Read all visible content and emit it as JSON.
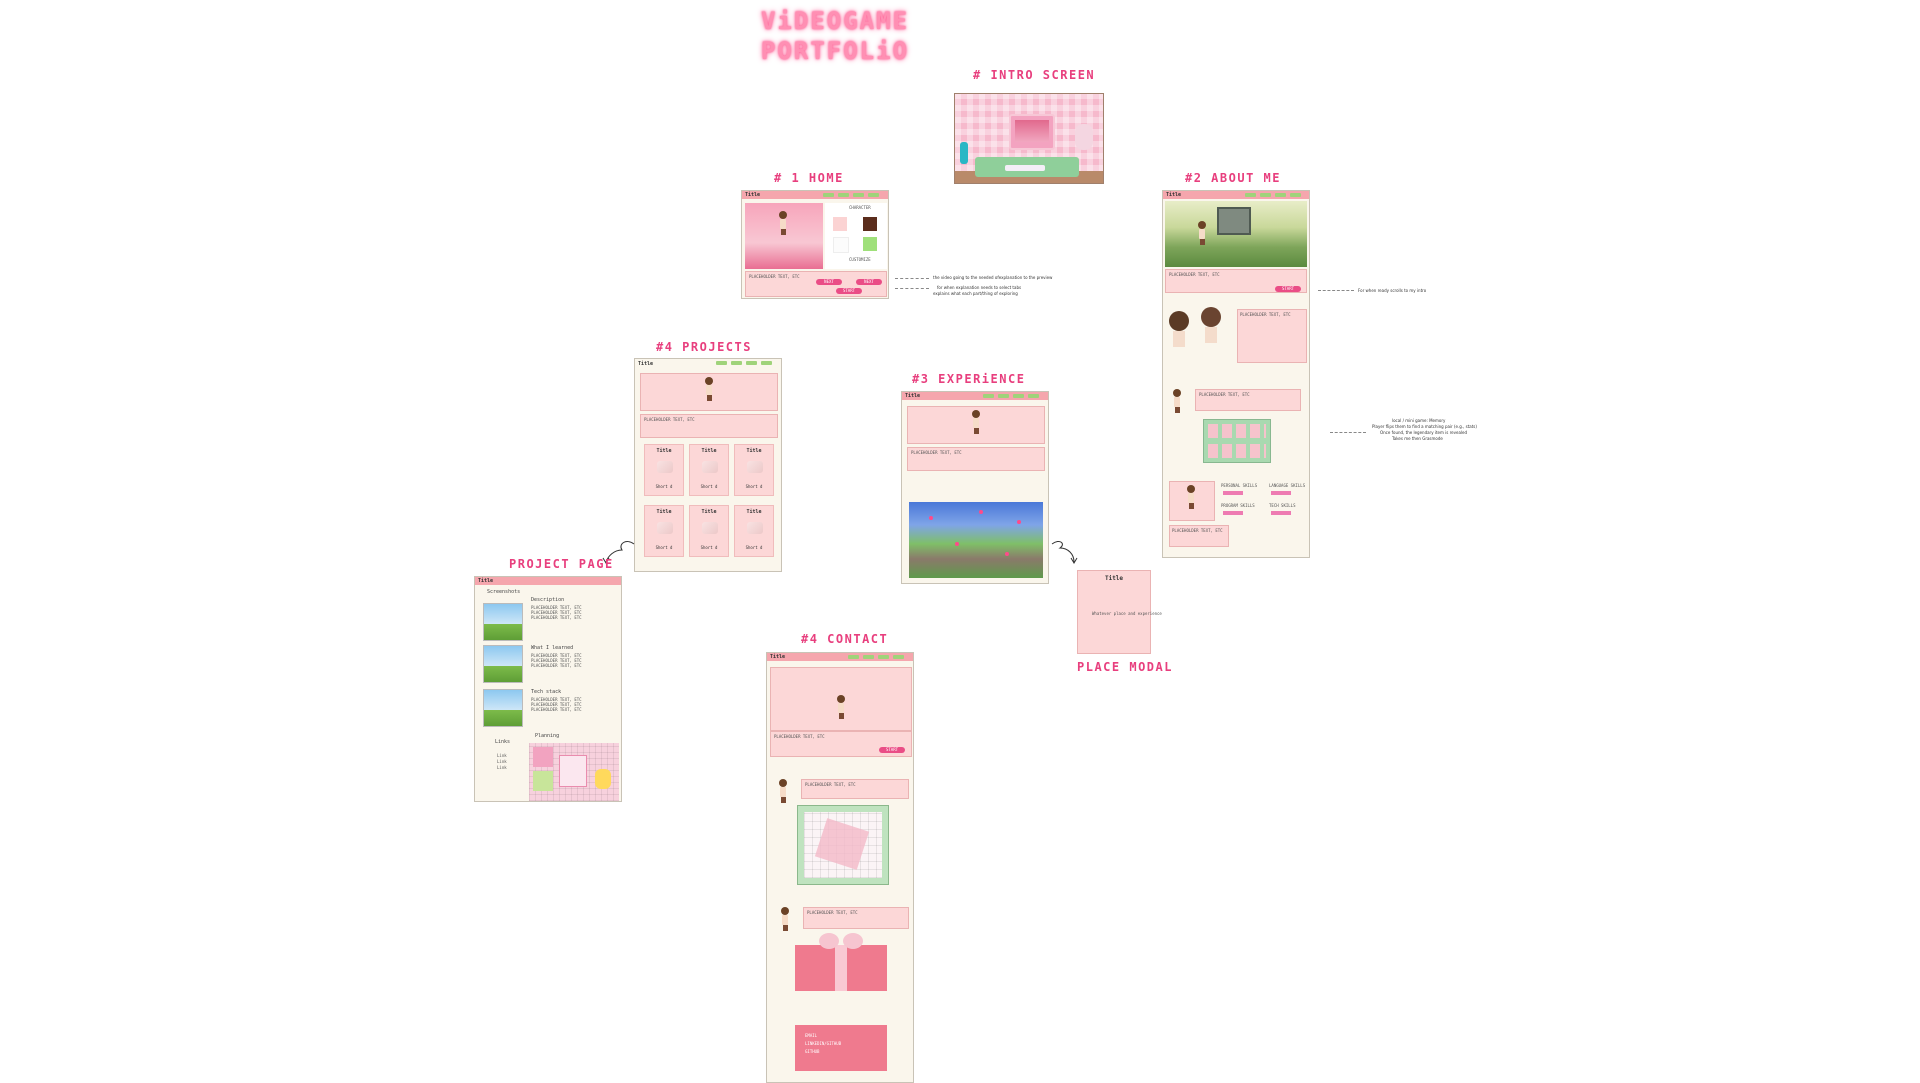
{
  "title_line1": "ViDEOGAME",
  "title_line2": "PORTFOLiO",
  "sections": {
    "intro": "# INTRO SCREEN",
    "home": "# 1  HOME",
    "about": "#2   ABOUT ME",
    "projects": "#4   PROJECTS",
    "experience": "#3   EXPERiENCE",
    "contact": "#4 CONTACT",
    "project_page": "PROJECT PAGE",
    "place_modal": "PLACE MODAL"
  },
  "frame_title": "Title",
  "placeholder_text": "PLACEHOLDER TEXT, ETC",
  "buttons": {
    "start": "START",
    "next": "NEXT"
  },
  "project_cards": [
    {
      "title": "Title",
      "sub": "Short d"
    },
    {
      "title": "Title",
      "sub": "Short d"
    },
    {
      "title": "Title",
      "sub": "Short d"
    },
    {
      "title": "Title",
      "sub": "Short d"
    },
    {
      "title": "Title",
      "sub": "Short d"
    },
    {
      "title": "Title",
      "sub": "Short d"
    }
  ],
  "project_page": {
    "screenshots": "Screenshots",
    "description": "Description",
    "learned": "What I learned",
    "tech": "Tech stack",
    "links": "Links",
    "planning": "Planning",
    "link_items": [
      "Link",
      "Link",
      "Link"
    ]
  },
  "modal": {
    "title": "Title",
    "text": "Whatever place and experience"
  },
  "annotations": {
    "home_1": "the video going to the needed ofexplanation to the preview",
    "home_2": "for when explanation needs to select tabs",
    "home_3": "explains what each part/thing of exploring",
    "about_1": "For when ready scrolls to my intro",
    "about_2a": "local / mini game: Memory",
    "about_2b": "Player flips them to find a matching pair (e.g., stats)",
    "about_2c": "Once found, the legendary item is revealed",
    "about_2d": "Takes me then Grasmode"
  },
  "about_skills": [
    "PERSONAL SKILLS",
    "LANGUAGE SKILLS",
    "PROGRAM SKILLS",
    "TECH SKILLS"
  ],
  "home_panel": {
    "label1": "CHARACTER",
    "label2": "CUSTOMIZE"
  },
  "contact_links": [
    "EMAIL",
    "LINKEDIN/GITHUB",
    "GITHUB"
  ],
  "colors": {
    "accent": "#e83f7e",
    "bar": "#f5a6ad",
    "panel": "#fcd7d7",
    "page": "#faf6ec",
    "nav": "#9fd37a"
  }
}
